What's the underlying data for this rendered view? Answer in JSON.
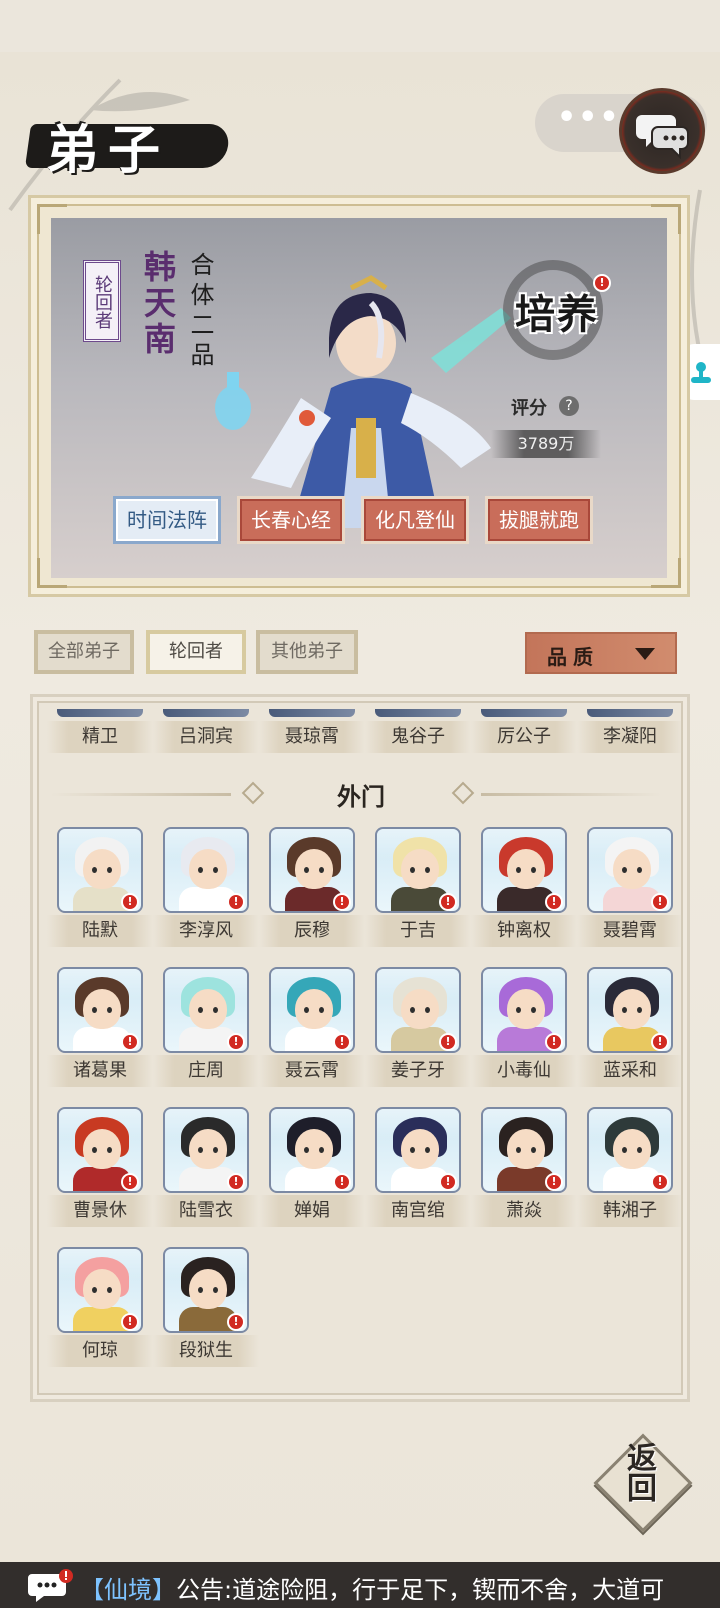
{
  "page": {
    "title": "弟子"
  },
  "hero": {
    "tag": "轮回者",
    "name": "韩天南",
    "rank": "合体二品",
    "cultivate_label": "培养",
    "score_label": "评分",
    "score_help": "?",
    "score_value": "3789万",
    "skills": [
      "时间法阵",
      "长春心经",
      "化凡登仙",
      "拔腿就跑"
    ]
  },
  "filters": {
    "tabs": [
      "全部弟子",
      "轮回者",
      "其他弟子"
    ],
    "active_tab": "轮回者",
    "quality_label": "品质"
  },
  "list": {
    "partial_row": [
      "精卫",
      "吕洞宾",
      "聂琼霄",
      "鬼谷子",
      "厉公子",
      "李凝阳"
    ],
    "section_title": "外门",
    "disciples": [
      "陆默",
      "李淳风",
      "辰穆",
      "于吉",
      "钟离权",
      "聂碧霄",
      "诸葛果",
      "庄周",
      "聂云霄",
      "姜子牙",
      "小毒仙",
      "蓝采和",
      "曹景休",
      "陆雪衣",
      "婵娟",
      "南宫绾",
      "萧焱",
      "韩湘子",
      "何琼",
      "段狱生"
    ]
  },
  "back_label": "返回",
  "announcement": {
    "tag": "【仙境】",
    "text": "公告:道途险阻，行于足下，锲而不舍，大道可"
  },
  "icons": [
    "more-dots-icon",
    "chat-icon",
    "help-icon",
    "dropdown-triangle-icon",
    "speech-bubble-icon",
    "notification-dot"
  ],
  "colors": {
    "skill_active": "#e4ecf5",
    "skill_normal": "#c96d5a",
    "red_dot": "#d12a22",
    "quality_button": "#c3755a"
  }
}
